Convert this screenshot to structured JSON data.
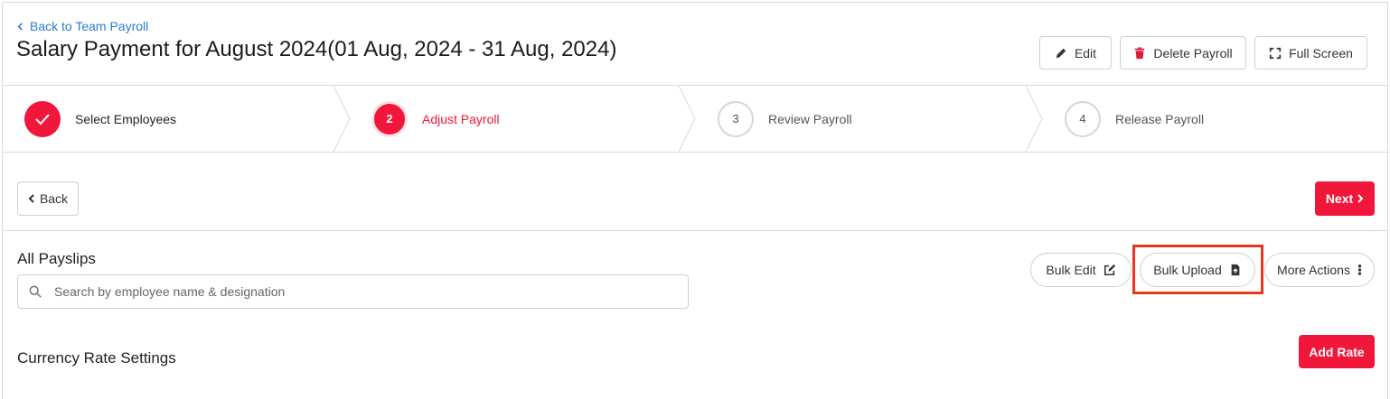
{
  "header": {
    "back_link": "Back to Team Payroll",
    "title": "Salary Payment for August 2024(01 Aug, 2024 - 31 Aug, 2024)",
    "actions": {
      "edit": "Edit",
      "delete": "Delete Payroll",
      "fullscreen": "Full Screen"
    }
  },
  "stepper": {
    "steps": [
      {
        "number": "",
        "label": "Select Employees",
        "state": "done"
      },
      {
        "number": "2",
        "label": "Adjust Payroll",
        "state": "active"
      },
      {
        "number": "3",
        "label": "Review Payroll",
        "state": "todo"
      },
      {
        "number": "4",
        "label": "Release Payroll",
        "state": "todo"
      }
    ]
  },
  "nav": {
    "back": "Back",
    "next": "Next"
  },
  "payslips": {
    "title": "All Payslips",
    "search_placeholder": "Search by employee name & designation",
    "bulk_edit": "Bulk Edit",
    "bulk_upload": "Bulk Upload",
    "more_actions": "More Actions"
  },
  "currency": {
    "title": "Currency Rate Settings",
    "add_rate": "Add Rate"
  },
  "colors": {
    "accent": "#f0173a",
    "link": "#2b7bd6",
    "highlight": "#e8361c"
  }
}
